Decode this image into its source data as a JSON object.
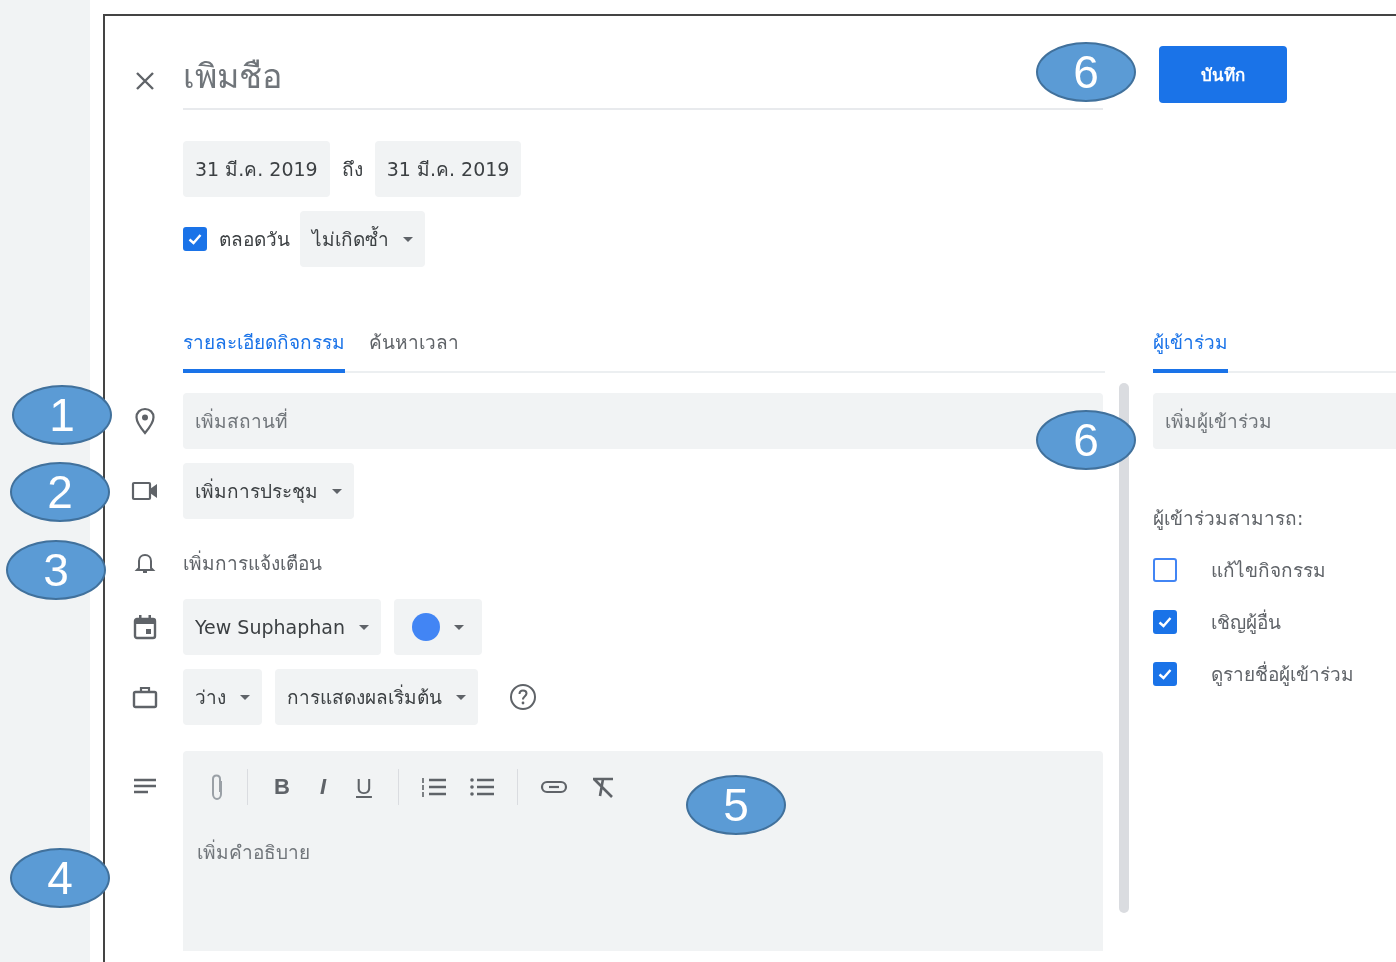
{
  "title_placeholder": "เพิมชือ",
  "save_button": "บันทึก",
  "dates": {
    "start": "31 มี.ค. 2019",
    "separator": "ถึง",
    "end": "31 มี.ค. 2019"
  },
  "all_day": {
    "label": "ตลอดวัน",
    "checked": true
  },
  "repeat": "ไม่เกิดซ้ำ",
  "tabs": [
    {
      "label": "รายละเอียดกิจกรรม",
      "selected": true
    },
    {
      "label": "ค้นหาเวลา",
      "selected": false
    }
  ],
  "location": {
    "placeholder": "เพิ่มสถานที่"
  },
  "conferencing": "เพิ่มการประชุม",
  "notification": "เพิ่มการแจ้งเตือน",
  "calendar": {
    "owner": "Yew Suphaphan",
    "color": "#4285f4"
  },
  "availability": "ว่าง",
  "visibility": "การแสดงผลเริ่มต้น",
  "format_buttons": [
    {
      "kind": "bold",
      "label": "B"
    },
    {
      "kind": "italic",
      "label": "I"
    },
    {
      "kind": "underline",
      "label": "U"
    }
  ],
  "description": {
    "placeholder": "เพิ่มคำอธิบาย"
  },
  "guests": {
    "tab": {
      "label": "ผู้เข้าร่วม",
      "selected": true
    },
    "placeholder": "เพิ่มผู้เข้าร่วม",
    "permissions_label": "ผู้เข้าร่วมสามารถ:",
    "permissions": [
      {
        "label": "แก้ไขกิจกรรม",
        "checked": false
      },
      {
        "label": "เชิญผู้อื่น",
        "checked": true
      },
      {
        "label": "ดูรายชื่อผู้เข้าร่วม",
        "checked": true
      }
    ]
  },
  "callouts": [
    {
      "label": "1"
    },
    {
      "label": "2"
    },
    {
      "label": "3"
    },
    {
      "label": "4"
    },
    {
      "label": "5"
    },
    {
      "label": "6"
    },
    {
      "label": "6"
    }
  ]
}
